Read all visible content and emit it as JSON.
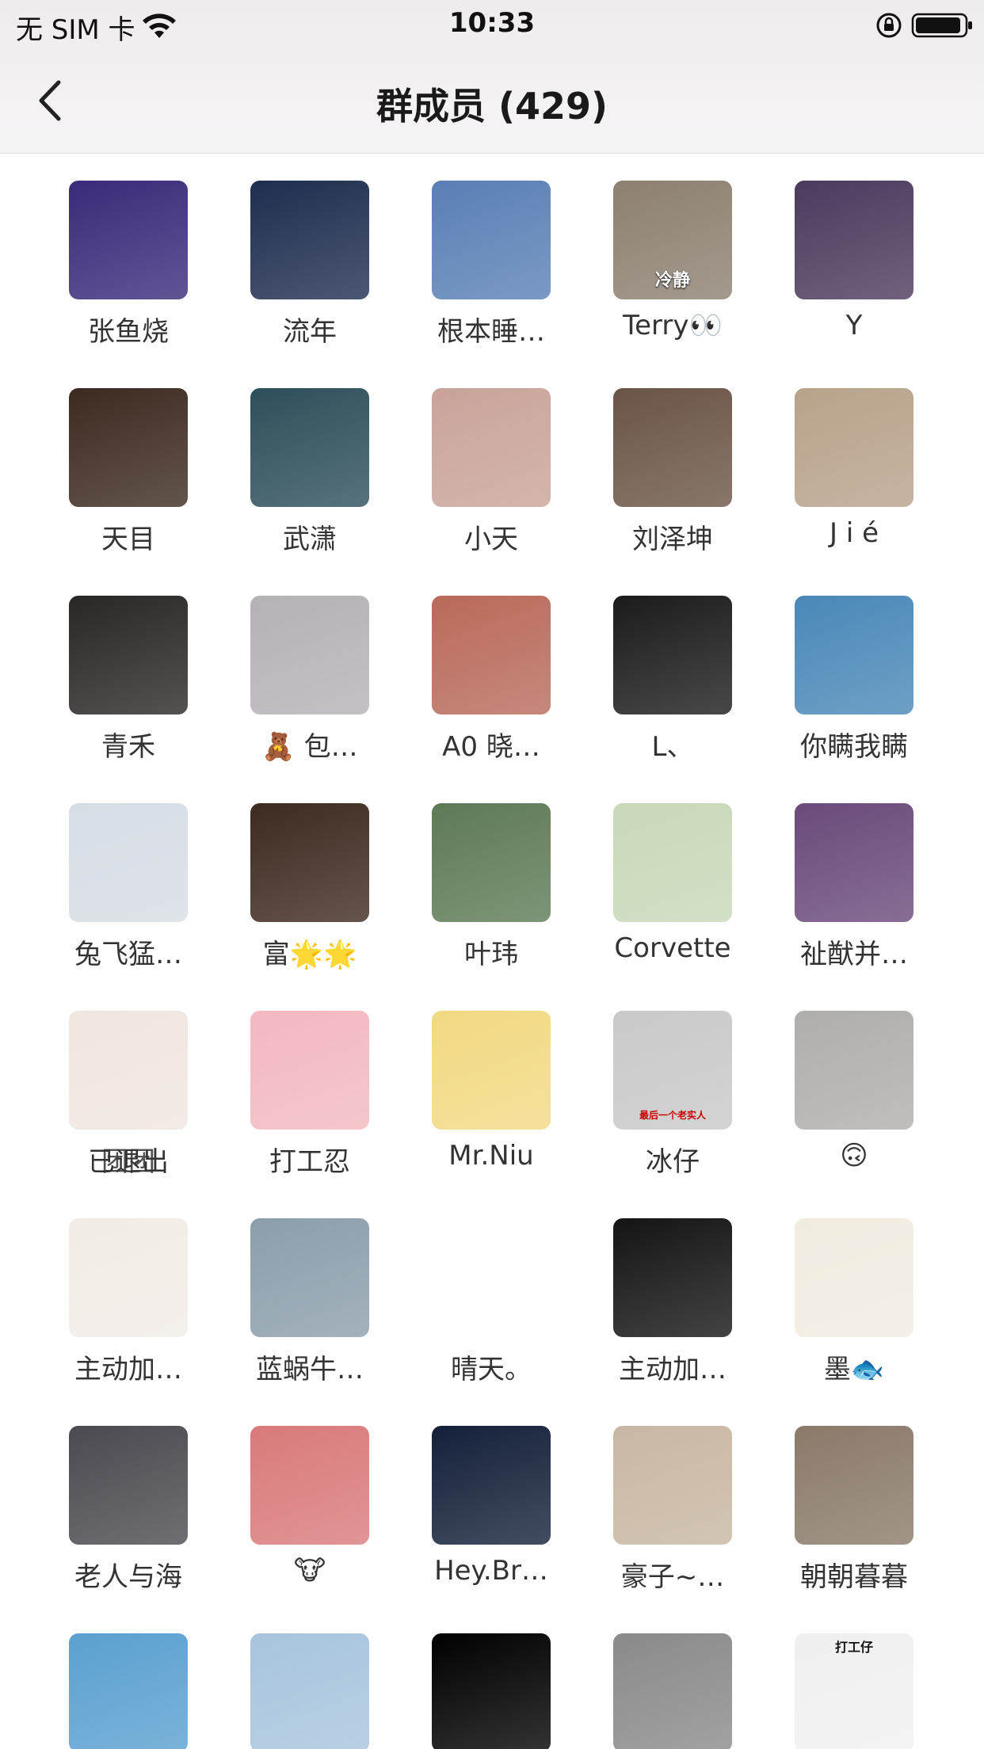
{
  "status_bar": {
    "carrier": "无 SIM 卡",
    "time": "10:33"
  },
  "nav": {
    "title": "群成员 (429)"
  },
  "colors": {
    "accent_orange": "#e24d2a",
    "background": "#ffffff"
  },
  "members": [
    {
      "name": "张鱼烧",
      "icon": "anime-fox-girl-avatar",
      "avatar_color": "#3a2a7a"
    },
    {
      "name": "流年",
      "icon": "night-moon-warriors-avatar",
      "avatar_color": "#1f2d4f"
    },
    {
      "name": "根本睡…",
      "icon": "jumping-cat-snow-avatar",
      "avatar_color": "#5a7fb5"
    },
    {
      "name": "Terry👀",
      "icon": "calm-sitting-person-avatar",
      "avatar_color": "#8d8071",
      "overlay_text": "冷静"
    },
    {
      "name": "Y",
      "icon": "boy-sunset-back-avatar",
      "avatar_color": "#4b3a5e"
    },
    {
      "name": "天目",
      "icon": "temple-night-avatar",
      "avatar_color": "#3c2a20"
    },
    {
      "name": "武潇",
      "icon": "ocean-calligraphy-avatar",
      "avatar_color": "#2d4f5a"
    },
    {
      "name": "小天",
      "icon": "girl-selfie-avatar",
      "avatar_color": "#c9a39a"
    },
    {
      "name": "刘泽坤",
      "icon": "man-sofa-avatar",
      "avatar_color": "#6b5447"
    },
    {
      "name": "J i é",
      "icon": "baby-photo-avatar",
      "avatar_color": "#b8a28a"
    },
    {
      "name": "青禾",
      "icon": "movie-heroes-avatar",
      "avatar_color": "#2a2626"
    },
    {
      "name": "🧸 包…",
      "icon": "hug-illustration-avatar",
      "avatar_color": "#b5b1b7"
    },
    {
      "name": "A0 晓…",
      "icon": "tianlong-game-avatar",
      "avatar_color": "#b96a5b"
    },
    {
      "name": "L、",
      "icon": "spiral-stairs-avatar",
      "avatar_color": "#1b1b1b"
    },
    {
      "name": "你瞒我瞒",
      "icon": "anime-boy-avatar",
      "avatar_color": "#4a88b8"
    },
    {
      "name": "兔飞猛…",
      "icon": "snow-tree-painting-avatar",
      "avatar_color": "#d6dde4"
    },
    {
      "name": "富🌟🌟",
      "icon": "man-drinking-avatar",
      "avatar_color": "#3d2a20"
    },
    {
      "name": "叶玮",
      "icon": "forest-river-avatar",
      "avatar_color": "#5e7a55"
    },
    {
      "name": "Corvette",
      "icon": "duck-plush-avatar",
      "avatar_color": "#c7d9b8"
    },
    {
      "name": "祉猷并…",
      "icon": "night-neon-street-avatar",
      "avatar_color": "#6a4a7a"
    },
    {
      "name": "已退出",
      "name_overlay": "团团",
      "icon": "new-year-cartoon-avatar",
      "avatar_color": "#f0e6e0"
    },
    {
      "name": "打工忍",
      "icon": "camera-boy-cartoon-avatar",
      "avatar_color": "#f3b8c0"
    },
    {
      "name": "Mr.Niu",
      "icon": "hoodie-boy-cartoon-avatar",
      "avatar_color": "#f2d983"
    },
    {
      "name": "冰仔",
      "icon": "smoking-kid-meme-avatar",
      "avatar_color": "#c9c9c9",
      "overlay_text": "最后一个老实人"
    },
    {
      "name": "🙃",
      "icon": "bear-shadow-avatar",
      "avatar_color": "#b0aeac"
    },
    {
      "name": "主动加…",
      "icon": "red-hat-girl-cartoon-avatar",
      "avatar_color": "#f2ece6"
    },
    {
      "name": "蓝蜗牛…",
      "icon": "man-on-yacht-avatar",
      "avatar_color": "#8c9eab"
    },
    {
      "name": "晴天。",
      "icon": "swag-duck-avatar",
      "avatar_color": "#ffffff"
    },
    {
      "name": "主动加…",
      "icon": "dark-tunnel-figure-avatar",
      "avatar_color": "#141414"
    },
    {
      "name": "墨🐟",
      "icon": "chinese-calligraphy-avatar",
      "avatar_color": "#f1ece0"
    },
    {
      "name": "老人与海",
      "icon": "selfie-man-avatar",
      "avatar_color": "#4a4a50"
    },
    {
      "name": "🐮",
      "icon": "brown-bear-avatar",
      "avatar_color": "#d97a7a"
    },
    {
      "name": "Hey.Br…",
      "icon": "football-player-avatar",
      "avatar_color": "#14203a"
    },
    {
      "name": "豪子~…",
      "icon": "bookshelf-man-avatar",
      "avatar_color": "#c8b7a2"
    },
    {
      "name": "朝朝暮暮",
      "icon": "sunset-river-avatar",
      "avatar_color": "#8a7a6a"
    },
    {
      "name": "",
      "icon": "worker-blue-cape-avatar",
      "avatar_color": "#5aa0d0"
    },
    {
      "name": "",
      "icon": "suit-boy-cartoon-avatar",
      "avatar_color": "#a7c4dd"
    },
    {
      "name": "",
      "icon": "black-square-avatar",
      "avatar_color": "#000000"
    },
    {
      "name": "",
      "icon": "boy-tea-avatar",
      "avatar_color": "#8a8a8a"
    },
    {
      "name": "",
      "icon": "worker-with-cap-avatar",
      "avatar_color": "#f0f0f0",
      "overlay_text": "打工仔"
    }
  ]
}
